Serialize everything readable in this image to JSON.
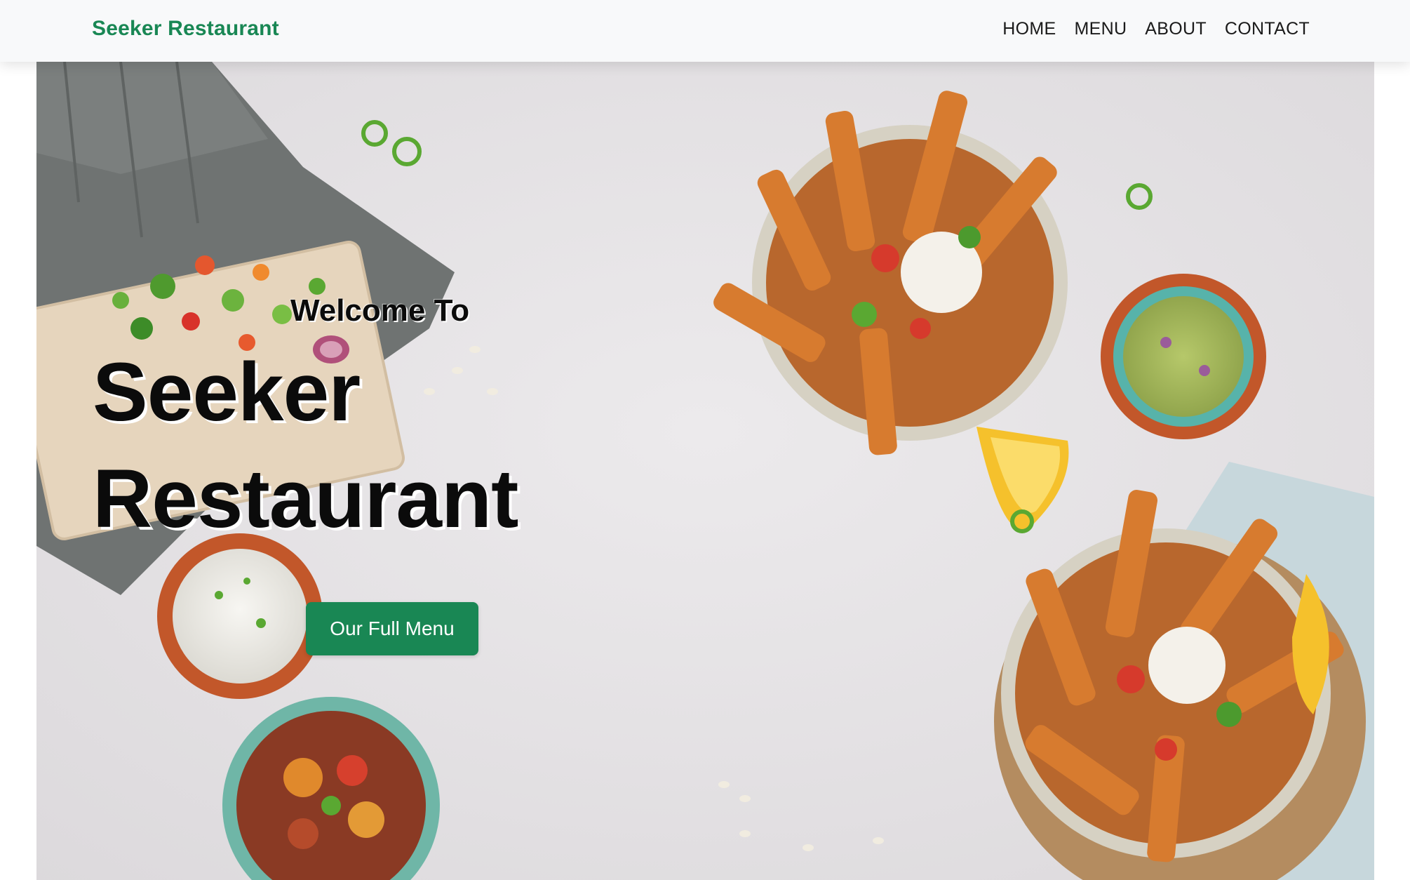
{
  "navbar": {
    "brand": "Seeker Restaurant",
    "links": [
      "HOME",
      "MENU",
      "ABOUT",
      "CONTACT"
    ]
  },
  "hero": {
    "welcome": "Welcome To",
    "title": "Seeker Restaurant",
    "button_label": "Our Full Menu",
    "background_image": "overhead-food-photo"
  },
  "colors": {
    "brand_green": "#198754",
    "navbar_bg": "#f8f9fa",
    "text_dark": "#0b0b0b"
  }
}
